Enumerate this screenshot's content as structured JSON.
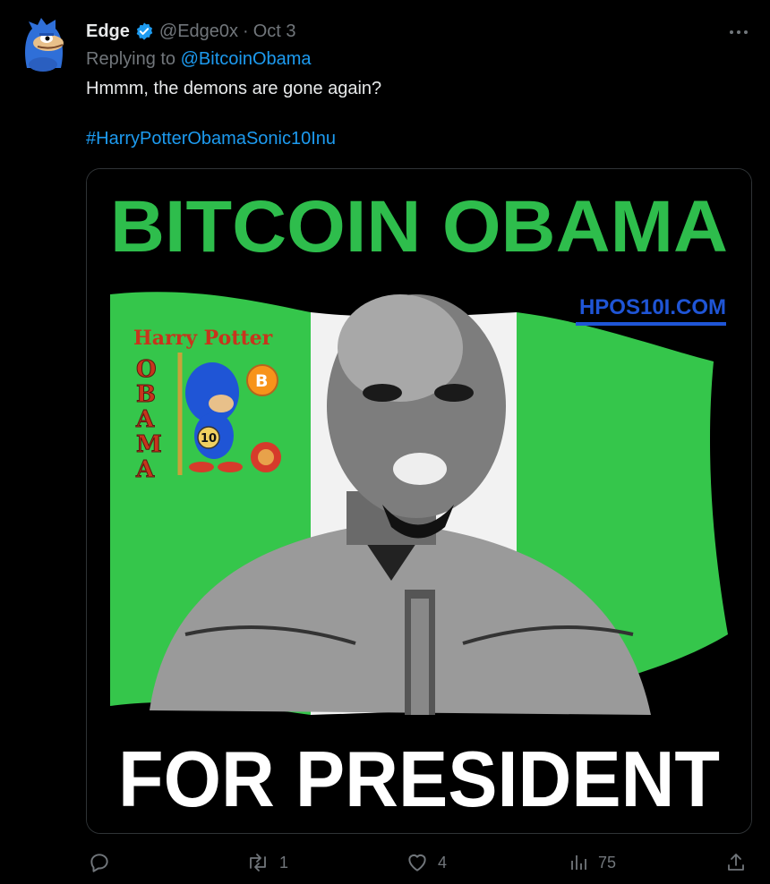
{
  "tweet": {
    "author_name": "Edge",
    "handle": "@Edge0x",
    "separator": "·",
    "date": "Oct 3",
    "replying_prefix": "Replying to ",
    "replying_to": "@BitcoinObama",
    "text": "Hmmm, the demons are gone again?",
    "hashtag": "#HarryPotterObamaSonic10Inu",
    "verified": true,
    "more_icon": "more-horizontal-icon"
  },
  "media": {
    "headline": "BITCOIN OBAMA",
    "url_text": "HPOS10I.COM",
    "logo_title": "Harry Potter",
    "logo_letters": [
      "O",
      "B",
      "A",
      "M",
      "A"
    ],
    "logo_badge": "10",
    "coin_symbol": "B",
    "footer": "FOR PRESIDENT",
    "colors": {
      "green": "#2ebd4c",
      "flag_green": "#35c64b",
      "url_blue": "#1f55d6",
      "background": "#000000"
    }
  },
  "actions": {
    "reply": {
      "icon": "reply-icon",
      "count": ""
    },
    "retweet": {
      "icon": "retweet-icon",
      "count": "1"
    },
    "like": {
      "icon": "heart-icon",
      "count": "4"
    },
    "views": {
      "icon": "views-icon",
      "count": "75"
    },
    "share": {
      "icon": "share-icon",
      "count": ""
    }
  },
  "colors": {
    "background": "#000000",
    "text": "#e7e9ea",
    "muted": "#71767b",
    "link": "#1d9bf0"
  }
}
